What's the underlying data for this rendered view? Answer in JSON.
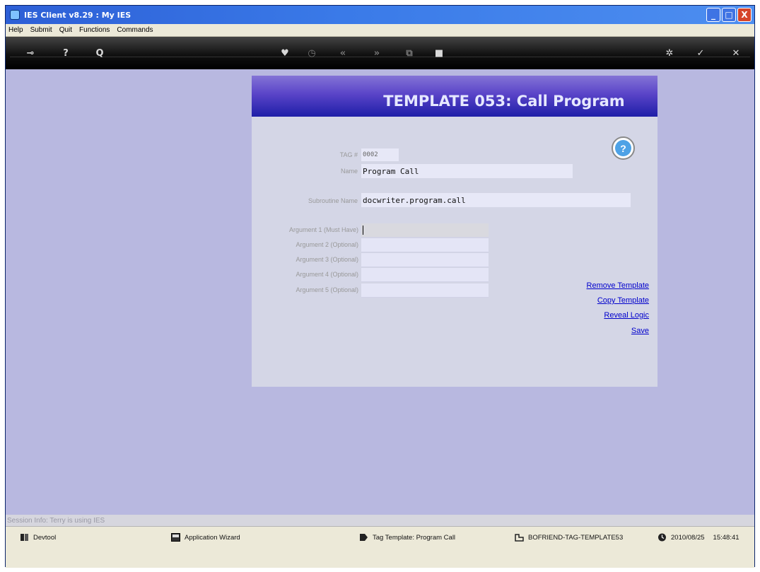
{
  "window": {
    "title": "IES Client v8.29 : My IES",
    "buttons": {
      "minimize": "_",
      "maximize": "□",
      "close": "X"
    }
  },
  "menu": [
    "Help",
    "Submit",
    "Quit",
    "Functions",
    "Commands"
  ],
  "toolbar": [
    {
      "icon": "key-icon",
      "glyph": "⊸"
    },
    {
      "icon": "help-icon",
      "glyph": "?"
    },
    {
      "icon": "search-icon",
      "glyph": "Q"
    },
    {
      "icon": "heart-icon",
      "glyph": "♥"
    },
    {
      "icon": "clock-icon",
      "glyph": "◷"
    },
    {
      "icon": "back-icon",
      "glyph": "«"
    },
    {
      "icon": "forward-icon",
      "glyph": "»"
    },
    {
      "icon": "copy-icon",
      "glyph": "⧉"
    },
    {
      "icon": "stop-icon",
      "glyph": "■"
    },
    {
      "icon": "settings-icon",
      "glyph": "✲"
    },
    {
      "icon": "ok-icon",
      "glyph": "✓"
    },
    {
      "icon": "close-icon",
      "glyph": "✕"
    }
  ],
  "panel": {
    "title": "TEMPLATE 053: Call Program",
    "tag_label": "TAG #",
    "tag_value": "0002",
    "name_label": "Name",
    "name_value": "Program Call",
    "subroutine_label": "Subroutine Name",
    "subroutine_value": "docwriter.program.call",
    "arguments": [
      {
        "label": "Argument 1 (Must Have)",
        "value": ""
      },
      {
        "label": "Argument 2 (Optional)",
        "value": ""
      },
      {
        "label": "Argument 3 (Optional)",
        "value": ""
      },
      {
        "label": "Argument 4 (Optional)",
        "value": ""
      },
      {
        "label": "Argument 5 (Optional)",
        "value": ""
      }
    ],
    "links": [
      "Remove Template",
      "Copy Template",
      "Reveal Logic",
      "Save"
    ]
  },
  "session": "Session Info: Terry is using IES",
  "status": {
    "devtool": "Devtool",
    "wizard": "Application Wizard",
    "tag_template": "Tag Template: Program Call",
    "object": "BOFRIEND-TAG-TEMPLATE53",
    "date": "2010/08/25",
    "time": "15:48:41"
  },
  "colors": {
    "desktop": "#b8b8e0",
    "header_top": "#8474d6",
    "header_bottom": "#1e1ea8",
    "link": "#0000cc"
  }
}
